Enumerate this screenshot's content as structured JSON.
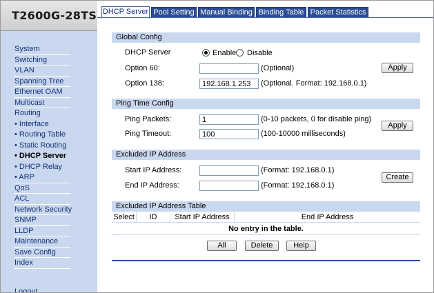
{
  "logo": "T2600G-28TS",
  "sidebar": {
    "items": [
      {
        "label": "System"
      },
      {
        "label": "Switching"
      },
      {
        "label": "VLAN"
      },
      {
        "label": "Spanning Tree"
      },
      {
        "label": "Ethernet OAM"
      },
      {
        "label": "Multicast"
      },
      {
        "label": "Routing"
      },
      {
        "label": "• Interface"
      },
      {
        "label": "• Routing Table"
      },
      {
        "label": "• Static Routing"
      },
      {
        "label": "• DHCP Server"
      },
      {
        "label": "• DHCP Relay"
      },
      {
        "label": "• ARP"
      },
      {
        "label": "QoS"
      },
      {
        "label": "ACL"
      },
      {
        "label": "Network Security"
      },
      {
        "label": "SNMP"
      },
      {
        "label": "LLDP"
      },
      {
        "label": "Maintenance"
      },
      {
        "label": "Save Config"
      },
      {
        "label": "Index"
      }
    ],
    "logout": "Logout"
  },
  "tabs": [
    {
      "label": "DHCP Server",
      "active": true
    },
    {
      "label": "Pool Setting"
    },
    {
      "label": "Manual Binding"
    },
    {
      "label": "Binding Table"
    },
    {
      "label": "Packet Statistics"
    }
  ],
  "global_config": {
    "title": "Global Config",
    "dhcp_server_label": "DHCP Server",
    "enable_label": "Enable",
    "disable_label": "Disable",
    "selected": "Enable",
    "option60_label": "Option 60:",
    "option60_value": "",
    "option60_hint": "(Optional)",
    "option138_label": "Option 138:",
    "option138_value": "192.168.1.253",
    "option138_hint": "(Optional. Format: 192.168.0.1)",
    "apply_label": "Apply"
  },
  "ping_config": {
    "title": "Ping Time Config",
    "packets_label": "Ping Packets:",
    "packets_value": "1",
    "packets_hint": "(0-10 packets, 0 for disable ping)",
    "timeout_label": "Ping Timeout:",
    "timeout_value": "100",
    "timeout_hint": "(100-10000 milliseconds)",
    "apply_label": "Apply"
  },
  "excluded": {
    "title": "Excluded IP Address",
    "start_label": "Start IP Address:",
    "start_value": "",
    "start_hint": "(Format: 192.168.0.1)",
    "end_label": "End IP Address:",
    "end_value": "",
    "end_hint": "(Format: 192.168.0.1)",
    "create_label": "Create"
  },
  "table": {
    "title": "Excluded IP Address Table",
    "columns": [
      "Select",
      "ID",
      "Start IP Address",
      "End IP Address"
    ],
    "empty_text": "No entry in the table.",
    "buttons": {
      "all": "All",
      "delete": "Delete",
      "help": "Help"
    }
  },
  "colors": {
    "sidebar_bg": "#c9d8ee",
    "section_bg": "#c9d8ee",
    "tab_bg": "#2a4d93",
    "menu_text": "#15317a"
  }
}
